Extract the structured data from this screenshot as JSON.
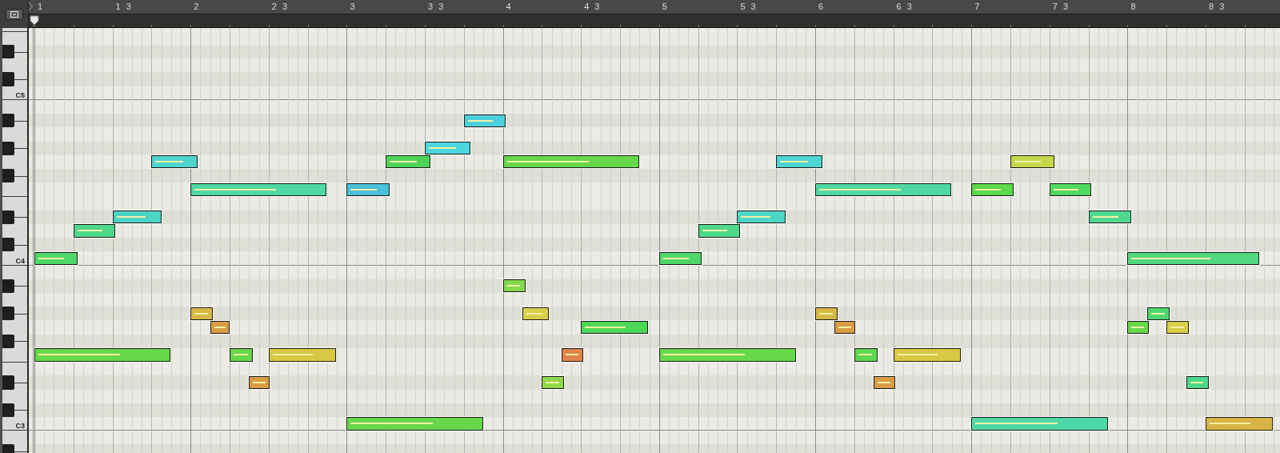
{
  "ruler": {
    "markers": [
      {
        "label": "1"
      },
      {
        "label": "1 3"
      },
      {
        "label": "2"
      },
      {
        "label": "2 3"
      },
      {
        "label": "3"
      },
      {
        "label": "3 3"
      },
      {
        "label": "4"
      },
      {
        "label": "4 3"
      },
      {
        "label": "5"
      },
      {
        "label": "5 3"
      },
      {
        "label": "6"
      },
      {
        "label": "6 3"
      },
      {
        "label": "7"
      },
      {
        "label": "7 3"
      },
      {
        "label": "8"
      },
      {
        "label": "8 3"
      }
    ]
  },
  "keyboard": {
    "labels": [
      {
        "label": "C5"
      },
      {
        "label": "C4"
      },
      {
        "label": "C3"
      }
    ]
  },
  "notes": [
    {
      "color": "#4fd869"
    },
    {
      "color": "#4fd869"
    },
    {
      "color": "#52d880"
    },
    {
      "color": "#4ed88a"
    },
    {
      "color": "#4ed88a"
    },
    {
      "color": "#4dd4c4"
    },
    {
      "color": "#4dd6c6"
    },
    {
      "color": "#4fd890"
    },
    {
      "color": "#4ed8a4"
    },
    {
      "color": "#4ac0dc"
    },
    {
      "color": "#4ed8a4"
    },
    {
      "color": "#5cd84a"
    },
    {
      "color": "#52d860"
    },
    {
      "color": "#4dd4cc"
    },
    {
      "color": "#4dd458"
    },
    {
      "color": "#66d84a"
    },
    {
      "color": "#4dd4d4"
    },
    {
      "color": "#c4d84a"
    },
    {
      "color": "#4ad8dc"
    },
    {
      "color": "#4ad0dc"
    },
    {
      "color": "#84d84a"
    },
    {
      "color": "#d8b846"
    },
    {
      "color": "#d8d048"
    },
    {
      "color": "#d8b846"
    },
    {
      "color": "#4dd870"
    },
    {
      "color": "#d89c46"
    },
    {
      "color": "#4dd858"
    },
    {
      "color": "#d89c46"
    },
    {
      "color": "#66d84a"
    },
    {
      "color": "#d8d048"
    },
    {
      "color": "#66d84a"
    },
    {
      "color": "#66d84a"
    },
    {
      "color": "#d8c844"
    },
    {
      "color": "#e0844a"
    },
    {
      "color": "#66d84a"
    },
    {
      "color": "#5cd84e"
    },
    {
      "color": "#d8c844"
    },
    {
      "color": "#d89c46"
    },
    {
      "color": "#8ed84a"
    },
    {
      "color": "#d89c46"
    },
    {
      "color": "#4dd88a"
    },
    {
      "color": "#66d84a"
    },
    {
      "color": "#4ed8a8"
    },
    {
      "color": "#d8b446"
    }
  ]
}
